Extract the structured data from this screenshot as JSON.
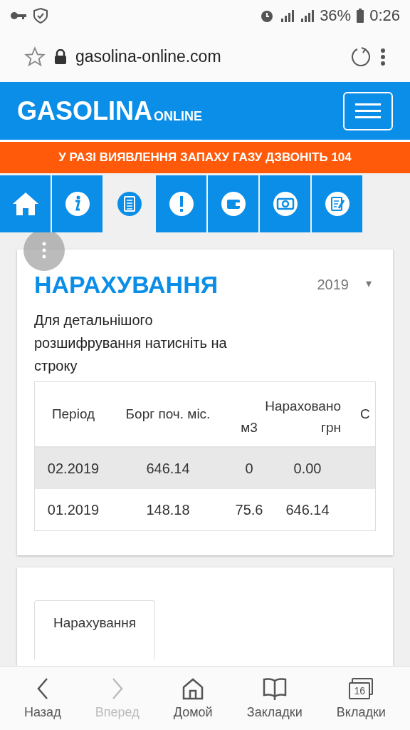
{
  "status_bar": {
    "battery": "36%",
    "time": "0:26"
  },
  "address_bar": {
    "url": "gasolina-online.com"
  },
  "header": {
    "logo": "GASOLINA",
    "logo_suffix": "ONLINE"
  },
  "alert": "У РАЗІ ВИЯВЛЕННЯ ЗАПАХУ ГАЗУ ДЗВОНІТЬ 104",
  "nav_tabs": [
    {
      "kind": "home",
      "selected": false
    },
    {
      "kind": "info",
      "selected": false
    },
    {
      "kind": "list",
      "selected": true
    },
    {
      "kind": "warning",
      "selected": false
    },
    {
      "kind": "wallet",
      "selected": false
    },
    {
      "kind": "money",
      "selected": false
    },
    {
      "kind": "edit",
      "selected": false
    }
  ],
  "card": {
    "title": "НАРАХУВАННЯ",
    "year": "2019",
    "year_caret": "▾",
    "hint": "Для детальнішого розшифрування натисніть на строку",
    "table": {
      "columns": [
        {
          "label": "Період"
        },
        {
          "label": "Борг поч. міс."
        },
        {
          "label": "Нараховано",
          "subcolumns": [
            "м3",
            "грн"
          ]
        },
        {
          "label": "С"
        }
      ],
      "rows": [
        {
          "selected": true,
          "cells": [
            "02.2019",
            "646.14",
            "0",
            "0.00"
          ]
        },
        {
          "selected": false,
          "cells": [
            "01.2019",
            "148.18",
            "75.6",
            "646.14"
          ]
        }
      ]
    }
  },
  "card2": {
    "tab": "Нарахування"
  },
  "bottom_bar": [
    {
      "kind": "back",
      "label": "Назад",
      "disabled": false
    },
    {
      "kind": "forward",
      "label": "Вперед",
      "disabled": true
    },
    {
      "kind": "home",
      "label": "Домой",
      "disabled": false
    },
    {
      "kind": "bookmarks",
      "label": "Закладки",
      "disabled": false
    },
    {
      "kind": "tabs",
      "label": "Вкладки",
      "disabled": false,
      "count": "16"
    }
  ]
}
